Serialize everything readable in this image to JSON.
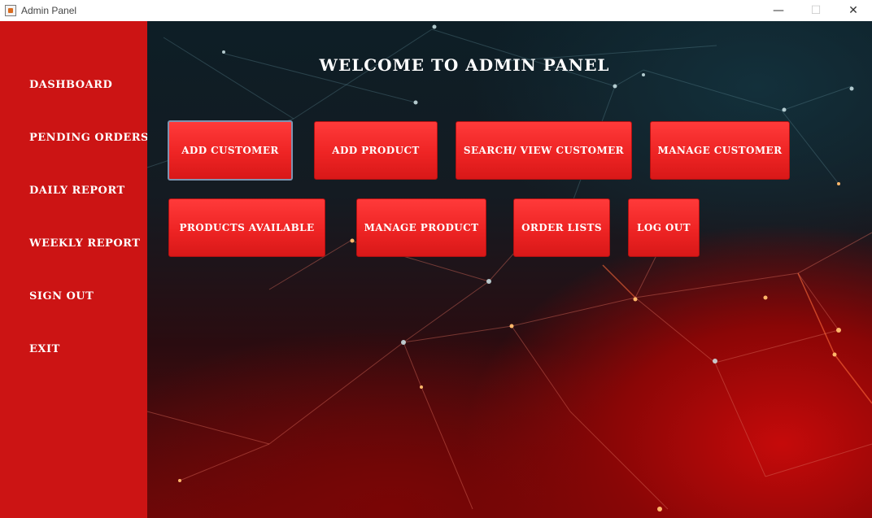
{
  "window": {
    "title": "Admin Panel",
    "minimize": "—",
    "maximize": "☐",
    "close": "✕"
  },
  "sidebar": {
    "items": [
      {
        "label": "DASHBOARD"
      },
      {
        "label": "PENDING ORDERS"
      },
      {
        "label": "DAILY REPORT"
      },
      {
        "label": "WEEKLY REPORT"
      },
      {
        "label": "SIGN OUT"
      },
      {
        "label": "EXIT"
      }
    ]
  },
  "main": {
    "heading": "WELCOME TO ADMIN PANEL",
    "buttons": [
      {
        "label": "ADD CUSTOMER"
      },
      {
        "label": "ADD PRODUCT"
      },
      {
        "label": "SEARCH/ VIEW CUSTOMER"
      },
      {
        "label": "MANAGE CUSTOMER"
      },
      {
        "label": "PRODUCTS AVAILABLE"
      },
      {
        "label": "MANAGE PRODUCT"
      },
      {
        "label": "ORDER LISTS"
      },
      {
        "label": "LOG OUT"
      }
    ]
  },
  "colors": {
    "sidebar": "#cc1414",
    "button": "#ee2424",
    "text": "#ffffff"
  }
}
